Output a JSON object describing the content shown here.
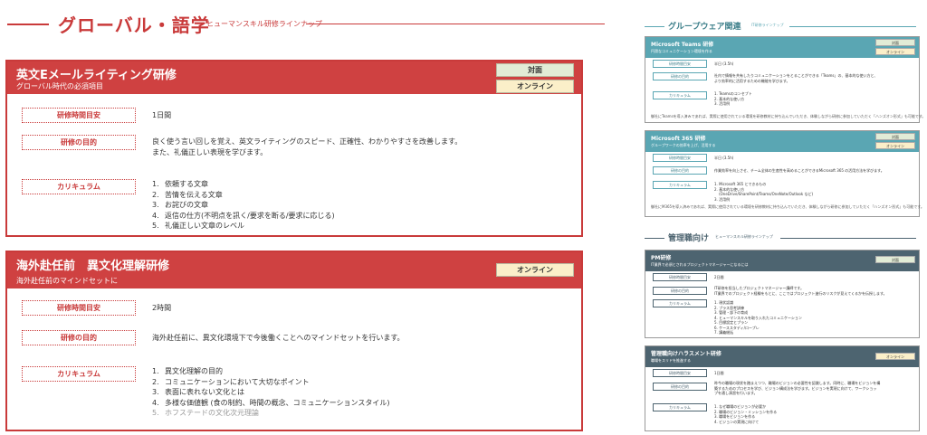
{
  "header": {
    "title": "グローバル・語学",
    "subtitle": "ヒューマンスキル研修ラインナップ"
  },
  "colors": {
    "red": "#c93a3a",
    "teal": "#5aa6b3",
    "slate": "#4d6470",
    "pill_green": "#e2ecd6",
    "pill_yellow": "#fbefc9"
  },
  "courses": [
    {
      "title": "英文Eメールライティング研修",
      "subtitle": "グローバル時代の必須項目",
      "badges": [
        "対面",
        "オンライン"
      ],
      "labels": {
        "duration": "研修時間目安",
        "purpose": "研修の目的",
        "curriculum": "カリキュラム"
      },
      "duration": "1日間",
      "purpose": [
        "良く使う言い回しを覚え、英文ライティングのスピード、正確性、わかりやすさを改善します。",
        "また、礼儀正しい表現を学びます。"
      ],
      "curriculum": [
        "依頼する文章",
        "苦情を伝える文章",
        "お詫びの文章",
        "返信の仕方(不明点を訊く/要求を断る/要求に応じる)",
        "礼儀正しい文章のレベル"
      ]
    },
    {
      "title": "海外赴任前　異文化理解研修",
      "subtitle": "海外赴任前のマインドセットに",
      "badges": [
        "オンライン"
      ],
      "labels": {
        "duration": "研修時間目安",
        "purpose": "研修の目的",
        "curriculum": "カリキュラム"
      },
      "duration": "2時間",
      "purpose": [
        "海外赴任前に、異文化環境下で今後働くことへのマインドセットを行います。"
      ],
      "curriculum": [
        "異文化理解の目的",
        "コミュニケーションにおいて大切なポイント",
        "表面に表れない文化とは",
        "多様な価値観 (食の制約、時間の概念、コミュニケーションスタイル)",
        "ホフステードの文化次元理論"
      ]
    }
  ],
  "right": {
    "groupware": {
      "title": "グループウェア関連",
      "subtitle": "IT研修ラインナップ",
      "cards": [
        {
          "title": "Microsoft Teams 研修",
          "subtitle": "円滑なコミュニケーション環境を作る",
          "badges": [
            "対面",
            "オンライン"
          ],
          "labels": [
            "研修時間目安",
            "研修の目的",
            "カリキュラム"
          ],
          "duration": "半日 (3.5h)",
          "purpose": [
            "社内で情報を共有したりコミュニケーションをとることができる「Teams」の、基本的な使い方と、",
            "より効率的に活用するための機能を学びます。"
          ],
          "curriculum": [
            "Teamsのコンセプト",
            "基本的な使い方",
            "活用例"
          ],
          "note": "御社にTeamsを導入済みであれば、実際に使用されている環境を研修教材に持ち込んでいただき、体験しながら研修に参加していただく「ハンズオン形式」も可能です。"
        },
        {
          "title": "Microsoft 365 研修",
          "subtitle": "グループワークの効率を上げ、活用する",
          "badges": [
            "対面",
            "オンライン"
          ],
          "labels": [
            "研修時間目安",
            "研修の目的",
            "カリキュラム"
          ],
          "duration": "半日 (3.5h)",
          "purpose": [
            "作業効率を向上させ、チーム全体の生産性を高めることができるMicrosoft 365 の活用方法を学びます。"
          ],
          "curriculum": [
            "Microsoft 365 とできるもの",
            "基本的な使い方",
            "(OneDrive/SharePoint/Teams/OneNote/Outlook など)",
            "活用例"
          ],
          "note": "御社にM365を導入済みであれば、実際に使用されている環境を研修教材に持ち込んでいただき、体験しながら研修に参加していただく「ハンズオン形式」も可能です。"
        }
      ]
    },
    "management": {
      "title": "管理職向け",
      "subtitle": "ヒューマンスキル研修ラインナップ",
      "cards": [
        {
          "title": "PM研修",
          "subtitle": "IT業界で必須とされるプロジェクトマネージャーになるには",
          "badges": [
            "対面"
          ],
          "labels": [
            "研修時間目安",
            "研修の目的",
            "カリキュラム"
          ],
          "duration": "2日間",
          "purpose": [
            "IT研修を担当したプロジェクトマネージャー講師です。",
            "IT業界でのプロジェクト経験をもとに、ここではプロジェクト進行のリスクが見えてくるかを伝授します。"
          ],
          "curriculum": [
            "現状認識",
            "プラス思考訓練",
            "管理・部下の育成",
            "ヒューマンスキルを取り入れたコミュニケーション",
            "目標設定とプラン",
            "ケーススタディ/ロープレ",
            "講義総括"
          ],
          "note": ""
        },
        {
          "title": "管理職向けハラスメント研修",
          "subtitle": "職場をスリドを推進する",
          "badges": [
            "オンライン"
          ],
          "labels": [
            "研修時間目安",
            "研修の目的",
            "カリキュラム"
          ],
          "duration": "1日間",
          "purpose": [
            "昨今の職場の現状を踏まえつつ、職場のビジョンの必要性を認識します。同時に、職場をビジョンを構",
            "築するためのプロセスを学び、ビジョン構成法を学びます。ビジョンを実現に向けて、ワークショッ",
            "プを通し演習を行います。"
          ],
          "curriculum": [
            "なぜ職場のビジョンが必要か",
            "職場のビジョン・ミッションを作る",
            "職場をビジョンを作る",
            "ビジョンの実現に向けて"
          ],
          "note": ""
        }
      ]
    }
  }
}
